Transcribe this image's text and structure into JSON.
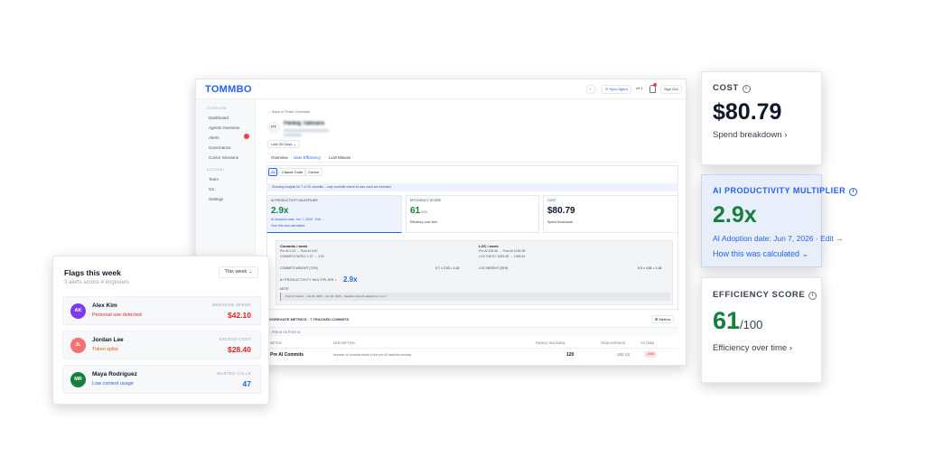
{
  "main": {
    "logo": "TOMMBO",
    "topbar": {
      "sync_agent": "Sync Agent",
      "version": "v9.1",
      "sign_out": "Sign Out"
    },
    "sidebar": {
      "section_overview": "OVERVIEW",
      "items_overview": [
        "Dashboard",
        "Agents Overview",
        "Alerts",
        "Governance",
        "Cursor Sessions"
      ],
      "section_account": "ACCOUNT",
      "items_account": [
        "Team",
        "Git",
        "Settings"
      ]
    },
    "back_link": "← Back to Team Overview",
    "user_initials": "PT",
    "user_name": "Pankaj Talesara",
    "date_range": "Last 30 Days",
    "tabs": [
      "Overview",
      "User Efficiency",
      "LLM Misuse"
    ],
    "filters": [
      "All",
      "Claude Code",
      "Cursor"
    ],
    "info_banner": "Showing insights for 7 of 20 commits – only commits where AI was used are included",
    "ai_mult": {
      "label": "AI PRODUCTIVITY MULTIPLIER",
      "value": "2.9x",
      "adoption": "AI Adoption date: Jun 7, 2026 · Edit →",
      "how": "How this was calculated"
    },
    "eff": {
      "label": "EFFICIENCY SCORE",
      "value": "61",
      "max": "/100",
      "link": "Efficiency over time"
    },
    "cost": {
      "label": "COST",
      "value": "$80.79",
      "link": "Spend breakdown"
    },
    "calc": {
      "commits_title": "Commits / week",
      "commits_line": "Pre AI 2.09 → Post AI 5.87",
      "commits_ratio": "COMMITS RATIO: 1.07 → 2.81",
      "loc_title": "LOC / week",
      "loc_line": "Pre AI 205.46 → Post AI 1439.28",
      "loc_ratio": "LOC RATIO: 1833.28 → 1336.44",
      "commit_weight_label": "COMMITS WEIGHT (70%)",
      "commit_weight_val": "0.7 × 2.03 = 1.42",
      "loc_weight_label": "LOC WEIGHT (30%)",
      "loc_weight_val": "0.3 × 4.81 = 1.44",
      "multiplier_label": "AI PRODUCTIVITY MULTIPLIER =",
      "multiplier_val": "2.9x",
      "note_label": "NOTE",
      "note_text": "Post AI metrics – Jun 22, 2026 – Jun 22, 2026 – baseline since AI adoption on Jun 7"
    },
    "table": {
      "title": "AGGREGATE METRICS · 7 TRACKED COMMITS",
      "metrics_btn": "Metrics",
      "sub": "PRE AI VS POST AI",
      "headers": [
        "METRIC",
        "DESCRIPTION",
        "PANKAJ TALESARA",
        "TEAM AVERAGE",
        "VS TEAM"
      ],
      "row": [
        "Pre AI Commits",
        "Number of commits taken in the pre AI baseline window",
        "120",
        "182.13",
        "-34%"
      ]
    }
  },
  "flags": {
    "title": "Flags this week",
    "sub": "3 alerts across 4 engineers",
    "filter": "This week",
    "rows": [
      {
        "initials": "AK",
        "name": "Alex Kim",
        "tag": "Personal use detected",
        "label": "WEEKEND SPEND",
        "value": "$42.10"
      },
      {
        "initials": "JL",
        "name": "Jordan Lee",
        "tag": "Token spike",
        "label": "EXCESS COST",
        "value": "$28.40"
      },
      {
        "initials": "MR",
        "name": "Maya Rodriguez",
        "tag": "Low context usage",
        "label": "WASTED CALLS",
        "value": "47"
      }
    ]
  },
  "cards": {
    "cost": {
      "label": "COST",
      "value": "$80.79",
      "link": "Spend breakdown"
    },
    "ai": {
      "label": "AI PRODUCTIVITY MULTIPLIER",
      "value": "2.9x",
      "adoption": "AI Adoption date: Jun 7, 2026 · Edit →",
      "how": "How this was calculated"
    },
    "eff": {
      "label": "EFFICIENCY SCORE",
      "value": "61",
      "max": "/100",
      "link": "Efficiency over time"
    }
  },
  "colors": {
    "accent": "#2563eb",
    "green": "#15803d",
    "red": "#dc2626",
    "ai_bg": "#e9eefb"
  }
}
